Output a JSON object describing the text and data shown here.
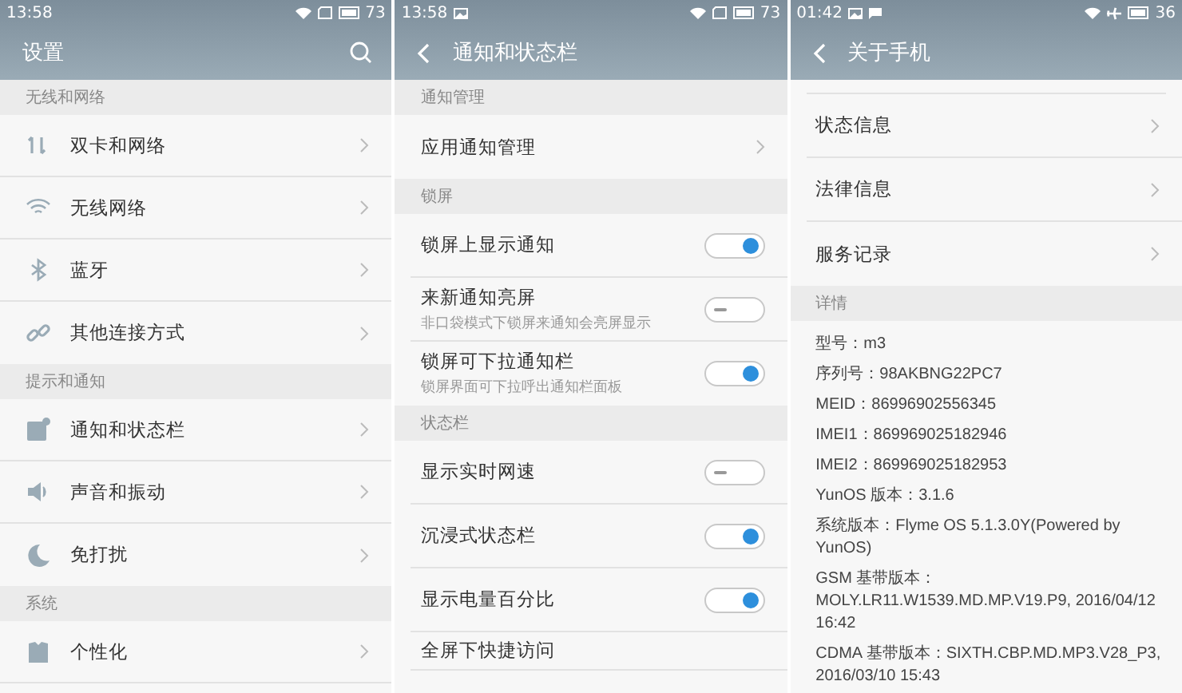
{
  "screens": [
    {
      "status_bar": {
        "time": "13:58",
        "airplane_mode": false,
        "battery": "73"
      },
      "header": {
        "kind": "root",
        "title": "设置"
      },
      "sections": [
        {
          "title": "无线和网络",
          "items": [
            {
              "kind": "icon_link",
              "label": "双卡和网络"
            },
            {
              "kind": "icon_link",
              "label": "无线网络"
            },
            {
              "kind": "icon_link",
              "label": "蓝牙"
            },
            {
              "kind": "icon_link",
              "label": "其他连接方式"
            }
          ]
        },
        {
          "title": "提示和通知",
          "items": [
            {
              "kind": "icon_link",
              "label": "通知和状态栏"
            },
            {
              "kind": "icon_link",
              "label": "声音和振动"
            },
            {
              "kind": "icon_link",
              "label": "免打扰"
            }
          ]
        },
        {
          "title": "系统",
          "items": [
            {
              "kind": "icon_link",
              "label": "个性化"
            }
          ]
        }
      ]
    },
    {
      "status_bar": {
        "time": "13:58",
        "notifications": [
          {
            "kind": "image"
          }
        ],
        "airplane_mode": false,
        "battery": "73"
      },
      "header": {
        "kind": "sub",
        "title": "通知和状态栏"
      },
      "sections": [
        {
          "title": "通知管理",
          "items": [
            {
              "kind": "link",
              "label": "应用通知管理"
            }
          ]
        },
        {
          "title": "锁屏",
          "items": [
            {
              "kind": "toggle",
              "label": "锁屏上显示通知",
              "on": true
            },
            {
              "kind": "toggle",
              "label": "来新通知亮屏",
              "subtitle": "非口袋模式下锁屏来通知会亮屏显示",
              "on": false
            },
            {
              "kind": "toggle",
              "label": "锁屏可下拉通知栏",
              "subtitle": "锁屏界面可下拉呼出通知栏面板",
              "on": true
            }
          ]
        },
        {
          "title": "状态栏",
          "items": [
            {
              "kind": "toggle",
              "label": "显示实时网速",
              "on": false
            },
            {
              "kind": "toggle",
              "label": "沉浸式状态栏",
              "on": true
            },
            {
              "kind": "toggle",
              "label": "显示电量百分比",
              "on": true
            },
            {
              "kind": "cut",
              "label": "全屏下快捷访问"
            }
          ]
        }
      ]
    },
    {
      "status_bar": {
        "time": "01:42",
        "notifications": [
          {
            "kind": "image"
          },
          {
            "kind": "message"
          }
        ],
        "airplane_mode": true,
        "battery": "36"
      },
      "header": {
        "kind": "sub",
        "title": "关于手机"
      },
      "sections": [
        {
          "items": [
            {
              "kind": "link",
              "label": "状态信息"
            },
            {
              "kind": "link",
              "label": "法律信息"
            },
            {
              "kind": "link",
              "label": "服务记录"
            }
          ]
        },
        {
          "title": "详情",
          "details": [
            "型号：m3",
            "序列号：98AKBNG22PC7",
            "MEID：86996902556345",
            "IMEI1：869969025182946",
            "IMEI2：869969025182953",
            "YunOS 版本：3.1.6",
            "系统版本：Flyme OS 5.1.3.0Y(Powered by YunOS)",
            "GSM 基带版本：MOLY.LR11.W1539.MD.MP.V19.P9, 2016/04/12 16:42",
            "CDMA 基带版本：SIXTH.CBP.MD.MP3.V28_P3, 2016/03/10 15:43"
          ]
        }
      ]
    }
  ]
}
